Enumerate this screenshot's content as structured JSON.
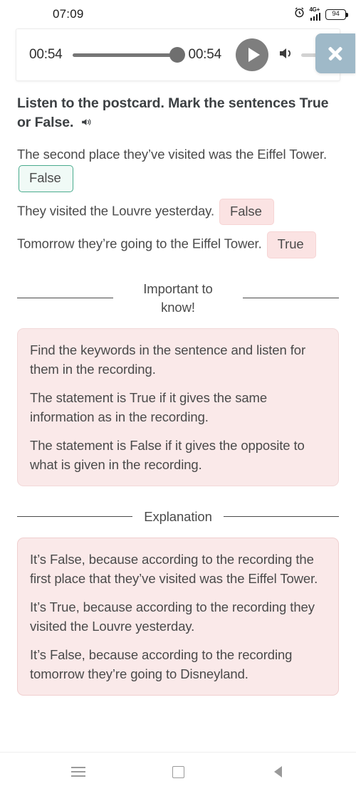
{
  "status_bar": {
    "time": "07:09",
    "alarm_icon": "alarm-clock-icon",
    "network_label": "4G+",
    "signal_icon": "signal-bars-icon",
    "battery_level": "94"
  },
  "audio_player": {
    "current_time": "00:54",
    "total_time": "00:54",
    "progress_percent": 100,
    "play_icon": "play-icon",
    "volume_icon": "volume-icon",
    "close_icon": "close-icon",
    "close_button_color": "#9fb9c8"
  },
  "question": {
    "title": "Listen to the postcard. Mark the sentences True or False.",
    "title_audio_icon": "speaker-icon",
    "statements": [
      {
        "text": "The second place they’ve visited was the Eiffel Tower.",
        "answer": "False",
        "state": "correct"
      },
      {
        "text": "They visited the Louvre yesterday.",
        "answer": "False",
        "state": "wrong"
      },
      {
        "text": "Tomorrow they’re going to the Eiffel Tower.",
        "answer": "True",
        "state": "wrong"
      }
    ]
  },
  "important_section": {
    "heading": "Important to know!",
    "paragraphs": [
      "Find the keywords in the sentence and listen for them in the recording.",
      "The statement is True if it gives the same information as in the recording.",
      "The statement is False if it gives the opposite to what is given in the recording."
    ]
  },
  "explanation_section": {
    "heading": "Explanation",
    "paragraphs": [
      "It’s False, because according to the recording the first place that they’ve visited was the Eiffel Tower.",
      "It’s True, because according to the recording they visited the Louvre yesterday.",
      "It’s False, because according to the recording tomorrow they’re going to Disneyland."
    ]
  },
  "nav_bar": {
    "recents_icon": "recents-menu-icon",
    "home_icon": "home-square-icon",
    "back_icon": "back-triangle-icon"
  },
  "colors": {
    "correct_border": "#4aab8e",
    "wrong_background": "#fbe3e3",
    "card_background": "#fae9e9",
    "accent_close": "#9fb9c8"
  }
}
